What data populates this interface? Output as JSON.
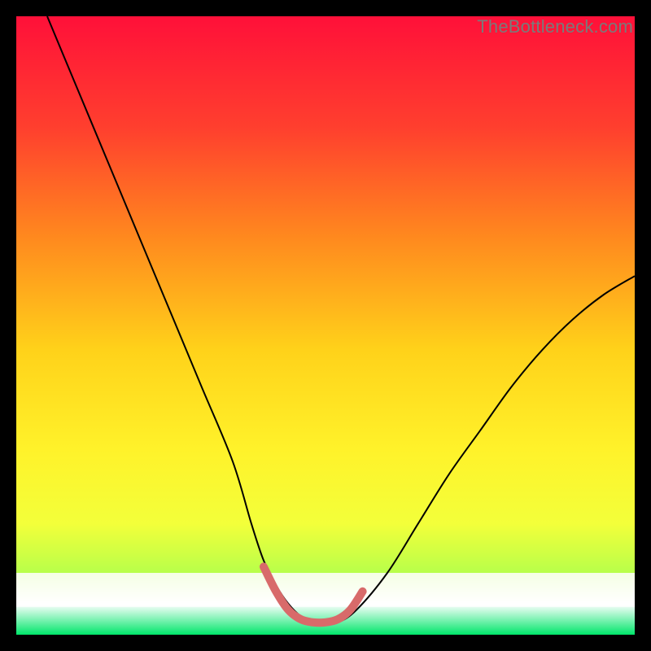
{
  "watermark": "TheBottleneck.com",
  "chart_data": {
    "type": "line",
    "title": "",
    "xlabel": "",
    "ylabel": "",
    "xlim": [
      0,
      100
    ],
    "ylim": [
      0,
      100
    ],
    "grid": false,
    "legend": false,
    "gradient_stops": [
      {
        "offset": 0,
        "color": "#ff1039"
      },
      {
        "offset": 18,
        "color": "#ff3f2e"
      },
      {
        "offset": 36,
        "color": "#ff8a1e"
      },
      {
        "offset": 54,
        "color": "#ffd21a"
      },
      {
        "offset": 70,
        "color": "#fff22a"
      },
      {
        "offset": 82,
        "color": "#f3ff3a"
      },
      {
        "offset": 90,
        "color": "#b8ff4a"
      },
      {
        "offset": 95,
        "color": "#ffffff"
      },
      {
        "offset": 100,
        "color": "#00e66a"
      }
    ],
    "series": [
      {
        "name": "bottleneck-curve",
        "stroke": "#000000",
        "stroke_width": 2,
        "x": [
          5,
          10,
          15,
          20,
          25,
          30,
          35,
          38,
          40,
          42,
          44,
          46,
          48,
          50,
          52,
          55,
          60,
          65,
          70,
          75,
          80,
          85,
          90,
          95,
          100
        ],
        "y": [
          100,
          88,
          76,
          64,
          52,
          40,
          28,
          18,
          12,
          8,
          5,
          3,
          2,
          2,
          2,
          4,
          10,
          18,
          26,
          33,
          40,
          46,
          51,
          55,
          58
        ]
      },
      {
        "name": "valley-marker",
        "stroke": "#d86a6a",
        "stroke_width": 10,
        "cap": "round",
        "x": [
          40,
          42,
          44,
          46,
          48,
          50,
          52,
          54,
          56
        ],
        "y": [
          11,
          7,
          4,
          2.5,
          2,
          2,
          2.5,
          4,
          7
        ]
      }
    ]
  }
}
